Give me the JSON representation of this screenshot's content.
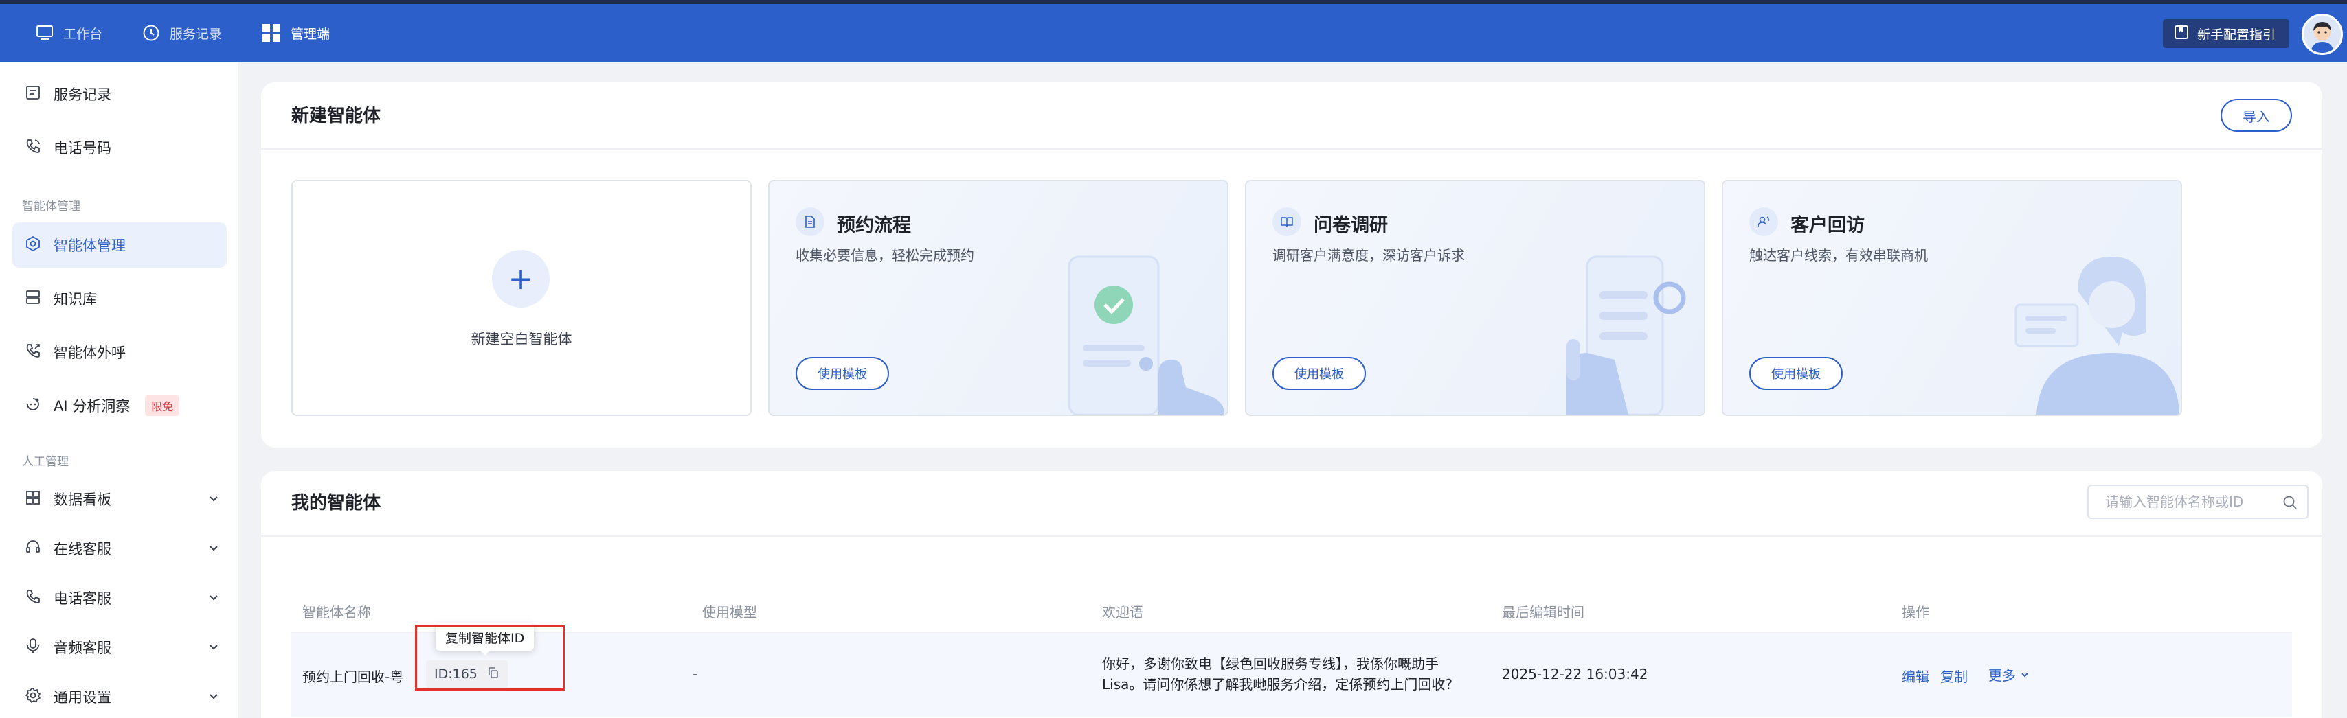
{
  "topnav": {
    "items": [
      {
        "label": "工作台",
        "icon": "monitor-icon"
      },
      {
        "label": "服务记录",
        "icon": "clock-icon"
      },
      {
        "label": "管理端",
        "icon": "grid-icon"
      }
    ],
    "guide_label": "新手配置指引"
  },
  "sidebar": {
    "items": [
      {
        "label": "服务记录"
      },
      {
        "label": "电话号码"
      },
      {
        "label": "智能体管理"
      },
      {
        "label": "知识库"
      },
      {
        "label": "智能体外呼"
      },
      {
        "label": "AI 分析洞察",
        "badge": "限免"
      },
      {
        "label": "数据看板"
      },
      {
        "label": "在线客服"
      },
      {
        "label": "电话客服"
      },
      {
        "label": "音频客服"
      },
      {
        "label": "通用设置"
      }
    ],
    "groups": [
      "智能体管理",
      "人工管理"
    ]
  },
  "create": {
    "title": "新建智能体",
    "import_label": "导入",
    "blank_label": "新建空白智能体",
    "templates": [
      {
        "title": "预约流程",
        "desc": "收集必要信息，轻松完成预约",
        "button": "使用模板"
      },
      {
        "title": "问卷调研",
        "desc": "调研客户满意度，深访客户诉求",
        "button": "使用模板"
      },
      {
        "title": "客户回访",
        "desc": "触达客户线索，有效串联商机",
        "button": "使用模板"
      }
    ]
  },
  "mine": {
    "title": "我的智能体",
    "search_placeholder": "请输入智能体名称或ID",
    "columns": [
      "智能体名称",
      "使用模型",
      "欢迎语",
      "最后编辑时间",
      "操作"
    ],
    "rows": [
      {
        "name": "预约上门回收-粤",
        "id": "ID:165",
        "model": "-",
        "greeting_line1": "你好，多谢你致电【绿色回收服务专线】，我係你嘅助手",
        "greeting_line2": "Lisa。请问你係想了解我哋服务介绍，定係预约上门回收?",
        "updated": "2025-12-22 16:03:42",
        "actions": {
          "edit": "编辑",
          "copy": "复制",
          "more": "更多"
        }
      }
    ],
    "tooltip": "复制智能体ID"
  },
  "colors": {
    "brand": "#2c5fc9",
    "highlight": "#e0312a",
    "badge": "#d9363e"
  }
}
